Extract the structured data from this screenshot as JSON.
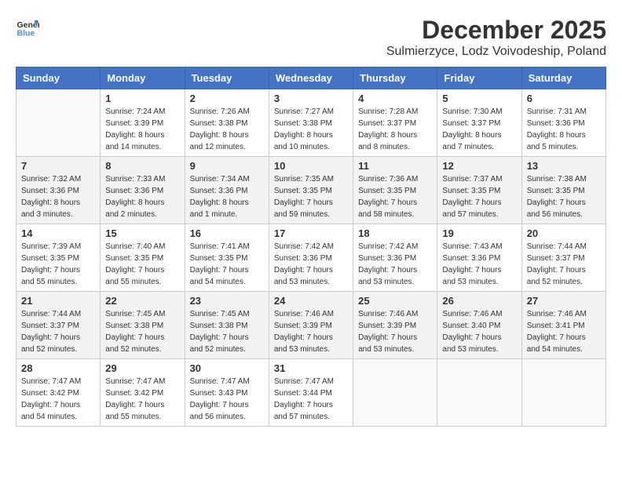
{
  "logo": {
    "general": "General",
    "blue": "Blue"
  },
  "title": {
    "month": "December 2025",
    "location": "Sulmierzyce, Lodz Voivodeship, Poland"
  },
  "weekdays": [
    "Sunday",
    "Monday",
    "Tuesday",
    "Wednesday",
    "Thursday",
    "Friday",
    "Saturday"
  ],
  "weeks": [
    [
      {
        "day": "",
        "sunrise": "",
        "sunset": "",
        "daylight": ""
      },
      {
        "day": "1",
        "sunrise": "Sunrise: 7:24 AM",
        "sunset": "Sunset: 3:39 PM",
        "daylight": "Daylight: 8 hours and 14 minutes."
      },
      {
        "day": "2",
        "sunrise": "Sunrise: 7:26 AM",
        "sunset": "Sunset: 3:38 PM",
        "daylight": "Daylight: 8 hours and 12 minutes."
      },
      {
        "day": "3",
        "sunrise": "Sunrise: 7:27 AM",
        "sunset": "Sunset: 3:38 PM",
        "daylight": "Daylight: 8 hours and 10 minutes."
      },
      {
        "day": "4",
        "sunrise": "Sunrise: 7:28 AM",
        "sunset": "Sunset: 3:37 PM",
        "daylight": "Daylight: 8 hours and 8 minutes."
      },
      {
        "day": "5",
        "sunrise": "Sunrise: 7:30 AM",
        "sunset": "Sunset: 3:37 PM",
        "daylight": "Daylight: 8 hours and 7 minutes."
      },
      {
        "day": "6",
        "sunrise": "Sunrise: 7:31 AM",
        "sunset": "Sunset: 3:36 PM",
        "daylight": "Daylight: 8 hours and 5 minutes."
      }
    ],
    [
      {
        "day": "7",
        "sunrise": "Sunrise: 7:32 AM",
        "sunset": "Sunset: 3:36 PM",
        "daylight": "Daylight: 8 hours and 3 minutes."
      },
      {
        "day": "8",
        "sunrise": "Sunrise: 7:33 AM",
        "sunset": "Sunset: 3:36 PM",
        "daylight": "Daylight: 8 hours and 2 minutes."
      },
      {
        "day": "9",
        "sunrise": "Sunrise: 7:34 AM",
        "sunset": "Sunset: 3:36 PM",
        "daylight": "Daylight: 8 hours and 1 minute."
      },
      {
        "day": "10",
        "sunrise": "Sunrise: 7:35 AM",
        "sunset": "Sunset: 3:35 PM",
        "daylight": "Daylight: 7 hours and 59 minutes."
      },
      {
        "day": "11",
        "sunrise": "Sunrise: 7:36 AM",
        "sunset": "Sunset: 3:35 PM",
        "daylight": "Daylight: 7 hours and 58 minutes."
      },
      {
        "day": "12",
        "sunrise": "Sunrise: 7:37 AM",
        "sunset": "Sunset: 3:35 PM",
        "daylight": "Daylight: 7 hours and 57 minutes."
      },
      {
        "day": "13",
        "sunrise": "Sunrise: 7:38 AM",
        "sunset": "Sunset: 3:35 PM",
        "daylight": "Daylight: 7 hours and 56 minutes."
      }
    ],
    [
      {
        "day": "14",
        "sunrise": "Sunrise: 7:39 AM",
        "sunset": "Sunset: 3:35 PM",
        "daylight": "Daylight: 7 hours and 55 minutes."
      },
      {
        "day": "15",
        "sunrise": "Sunrise: 7:40 AM",
        "sunset": "Sunset: 3:35 PM",
        "daylight": "Daylight: 7 hours and 55 minutes."
      },
      {
        "day": "16",
        "sunrise": "Sunrise: 7:41 AM",
        "sunset": "Sunset: 3:35 PM",
        "daylight": "Daylight: 7 hours and 54 minutes."
      },
      {
        "day": "17",
        "sunrise": "Sunrise: 7:42 AM",
        "sunset": "Sunset: 3:36 PM",
        "daylight": "Daylight: 7 hours and 53 minutes."
      },
      {
        "day": "18",
        "sunrise": "Sunrise: 7:42 AM",
        "sunset": "Sunset: 3:36 PM",
        "daylight": "Daylight: 7 hours and 53 minutes."
      },
      {
        "day": "19",
        "sunrise": "Sunrise: 7:43 AM",
        "sunset": "Sunset: 3:36 PM",
        "daylight": "Daylight: 7 hours and 53 minutes."
      },
      {
        "day": "20",
        "sunrise": "Sunrise: 7:44 AM",
        "sunset": "Sunset: 3:37 PM",
        "daylight": "Daylight: 7 hours and 52 minutes."
      }
    ],
    [
      {
        "day": "21",
        "sunrise": "Sunrise: 7:44 AM",
        "sunset": "Sunset: 3:37 PM",
        "daylight": "Daylight: 7 hours and 52 minutes."
      },
      {
        "day": "22",
        "sunrise": "Sunrise: 7:45 AM",
        "sunset": "Sunset: 3:38 PM",
        "daylight": "Daylight: 7 hours and 52 minutes."
      },
      {
        "day": "23",
        "sunrise": "Sunrise: 7:45 AM",
        "sunset": "Sunset: 3:38 PM",
        "daylight": "Daylight: 7 hours and 52 minutes."
      },
      {
        "day": "24",
        "sunrise": "Sunrise: 7:46 AM",
        "sunset": "Sunset: 3:39 PM",
        "daylight": "Daylight: 7 hours and 53 minutes."
      },
      {
        "day": "25",
        "sunrise": "Sunrise: 7:46 AM",
        "sunset": "Sunset: 3:39 PM",
        "daylight": "Daylight: 7 hours and 53 minutes."
      },
      {
        "day": "26",
        "sunrise": "Sunrise: 7:46 AM",
        "sunset": "Sunset: 3:40 PM",
        "daylight": "Daylight: 7 hours and 53 minutes."
      },
      {
        "day": "27",
        "sunrise": "Sunrise: 7:46 AM",
        "sunset": "Sunset: 3:41 PM",
        "daylight": "Daylight: 7 hours and 54 minutes."
      }
    ],
    [
      {
        "day": "28",
        "sunrise": "Sunrise: 7:47 AM",
        "sunset": "Sunset: 3:42 PM",
        "daylight": "Daylight: 7 hours and 54 minutes."
      },
      {
        "day": "29",
        "sunrise": "Sunrise: 7:47 AM",
        "sunset": "Sunset: 3:42 PM",
        "daylight": "Daylight: 7 hours and 55 minutes."
      },
      {
        "day": "30",
        "sunrise": "Sunrise: 7:47 AM",
        "sunset": "Sunset: 3:43 PM",
        "daylight": "Daylight: 7 hours and 56 minutes."
      },
      {
        "day": "31",
        "sunrise": "Sunrise: 7:47 AM",
        "sunset": "Sunset: 3:44 PM",
        "daylight": "Daylight: 7 hours and 57 minutes."
      },
      {
        "day": "",
        "sunrise": "",
        "sunset": "",
        "daylight": ""
      },
      {
        "day": "",
        "sunrise": "",
        "sunset": "",
        "daylight": ""
      },
      {
        "day": "",
        "sunrise": "",
        "sunset": "",
        "daylight": ""
      }
    ]
  ]
}
